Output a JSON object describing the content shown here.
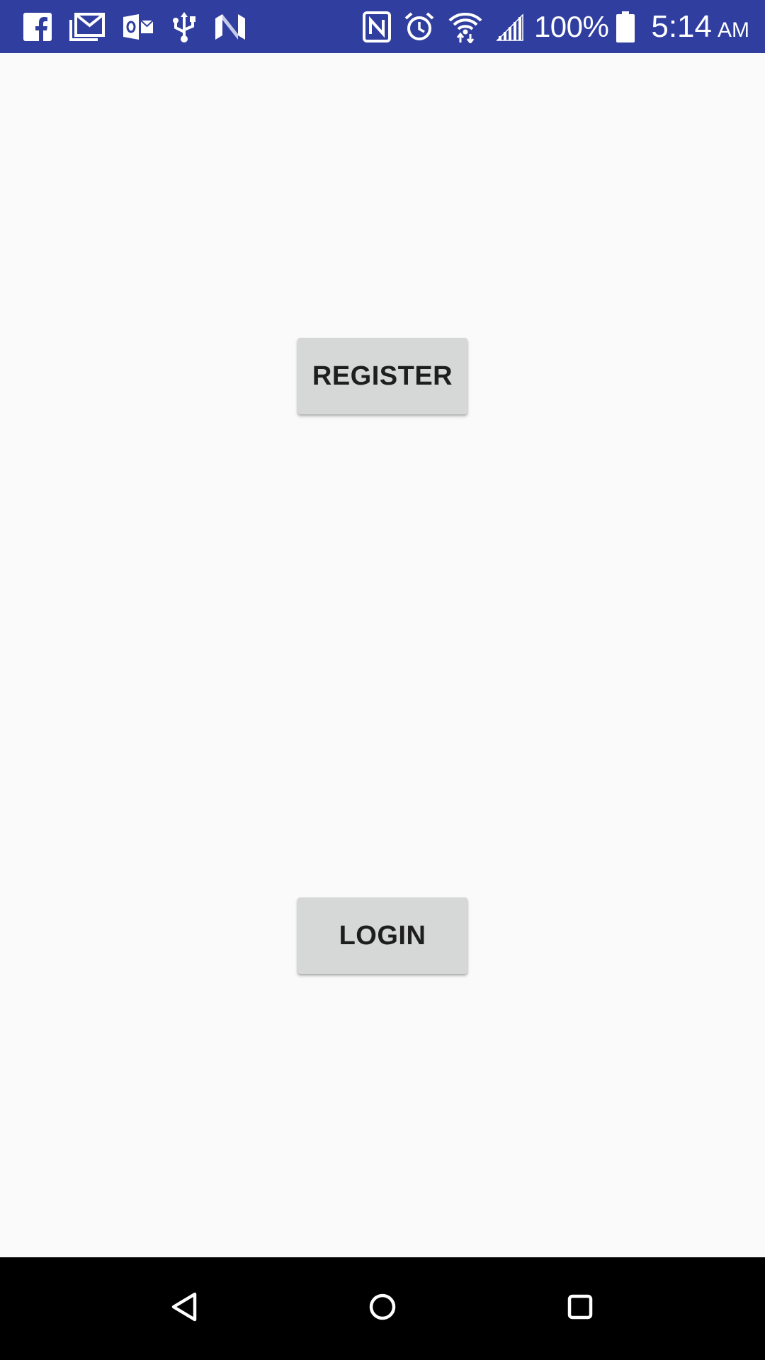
{
  "status_bar": {
    "background": "#303f9f",
    "left_icons": [
      "facebook-icon",
      "gmail-icon",
      "outlook-icon",
      "usb-icon",
      "n-app-icon"
    ],
    "right_icons": [
      "nfc-icon",
      "alarm-icon",
      "wifi-icon",
      "cell-signal-icon",
      "battery-icon"
    ],
    "battery_percent": "100%",
    "time": "5:14",
    "ampm": "AM"
  },
  "main": {
    "register_label": "REGISTER",
    "login_label": "LOGIN",
    "button_color": "#d6d7d7"
  },
  "nav_bar": {
    "buttons": [
      "back-icon",
      "home-icon",
      "recents-icon"
    ]
  }
}
